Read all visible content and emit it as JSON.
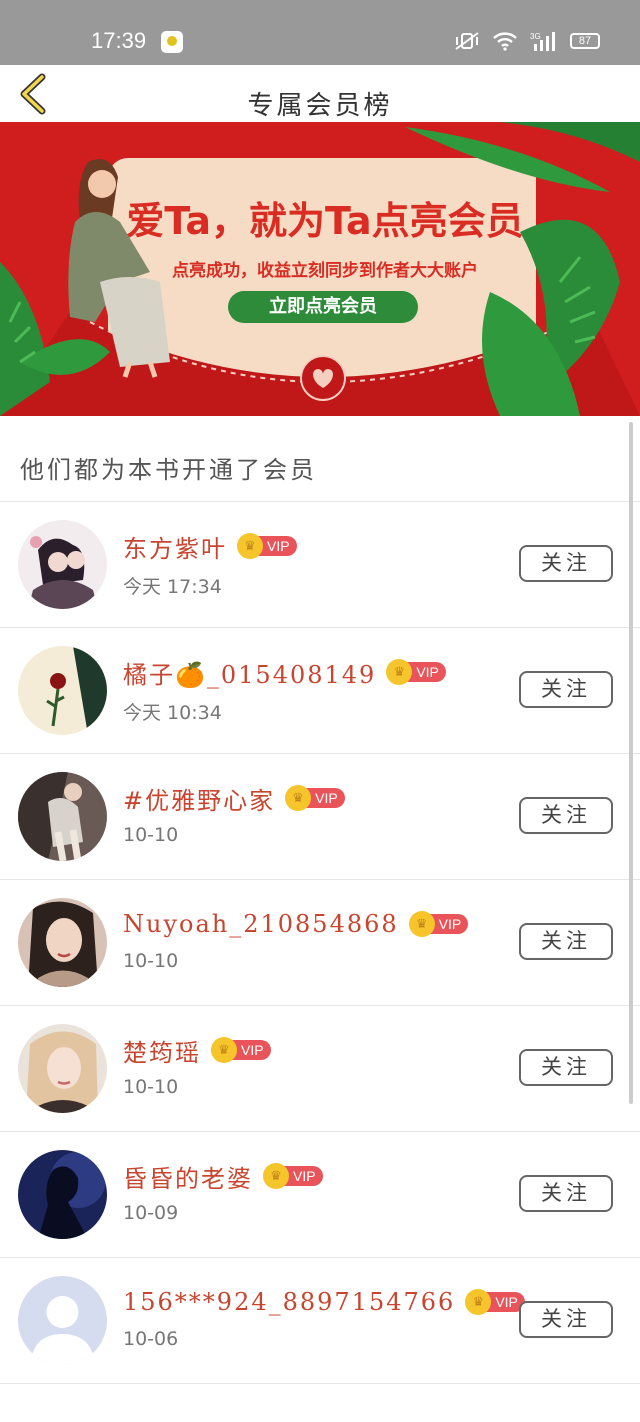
{
  "status_bar": {
    "time": "17:39",
    "battery": "87",
    "network": "3G"
  },
  "header": {
    "title": "专属会员榜"
  },
  "banner": {
    "headline": "爱Ta，就为Ta点亮会员",
    "subline": "点亮成功，收益立刻同步到作者大大账户",
    "button": "立即点亮会员"
  },
  "section": {
    "title": "他们都为本书开通了会员"
  },
  "vip_label": "VIP",
  "follow_label": "关注",
  "members": [
    {
      "name": "东方紫叶",
      "date": "今天 17:34"
    },
    {
      "name": "橘子🍊_015408149",
      "date": "今天 10:34"
    },
    {
      "name": "#优雅野心家",
      "date": "10-10"
    },
    {
      "name": "Nuyoah_210854868",
      "date": "10-10"
    },
    {
      "name": "楚筠瑶",
      "date": "10-10"
    },
    {
      "name": "昏昏的老婆",
      "date": "10-09"
    },
    {
      "name": "156***924_8897154766",
      "date": "10-06"
    }
  ],
  "colors": {
    "accent_red": "#c8452f",
    "banner_red": "#d01e1e",
    "button_green": "#2e8b3a",
    "vip_red": "#e8545a",
    "crown_gold": "#f5c52b"
  }
}
